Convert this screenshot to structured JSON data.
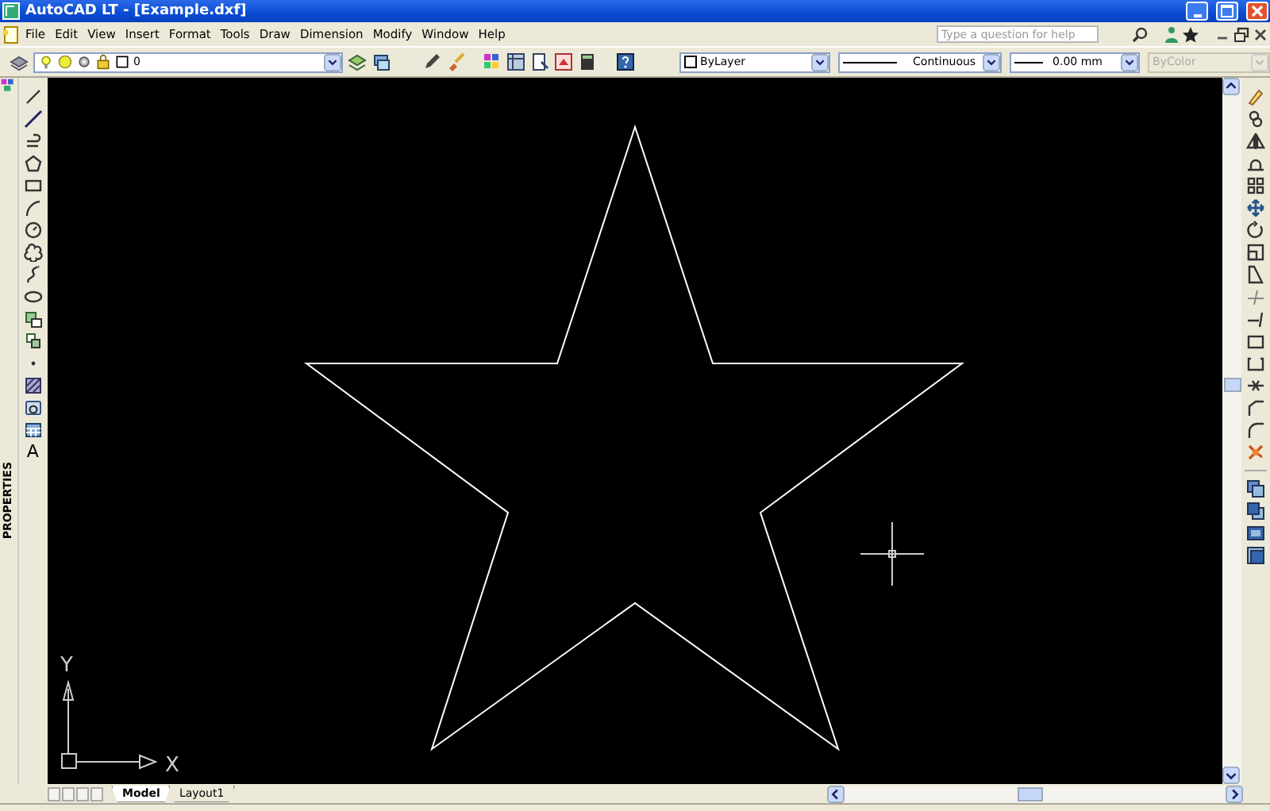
{
  "window": {
    "title": "AutoCAD LT - [Example.dxf]"
  },
  "menu": [
    {
      "label": "File"
    },
    {
      "label": "Edit"
    },
    {
      "label": "View"
    },
    {
      "label": "Insert"
    },
    {
      "label": "Format"
    },
    {
      "label": "Tools"
    },
    {
      "label": "Draw"
    },
    {
      "label": "Dimension"
    },
    {
      "label": "Modify"
    },
    {
      "label": "Window"
    },
    {
      "label": "Help"
    }
  ],
  "help_search": {
    "placeholder": "Type a question for help"
  },
  "toolbar": {
    "layer": {
      "value": "0"
    },
    "properties": [
      {
        "kind": "color",
        "value": "ByLayer",
        "disabled": false
      },
      {
        "kind": "linetype",
        "value": "Continuous",
        "disabled": false
      },
      {
        "kind": "lineweight",
        "value": "0.00 mm",
        "disabled": false
      },
      {
        "kind": "plotstyle",
        "value": "ByColor",
        "disabled": true
      }
    ]
  },
  "side_palette": {
    "label": "PROPERTIES"
  },
  "draw_toolbar": {
    "text_tool_glyph": "A"
  },
  "canvas": {
    "axis_x": "X",
    "axis_y": "Y"
  },
  "layout_tabs": [
    {
      "label": "Model",
      "selected": true
    },
    {
      "label": "Layout1",
      "selected": false
    }
  ]
}
